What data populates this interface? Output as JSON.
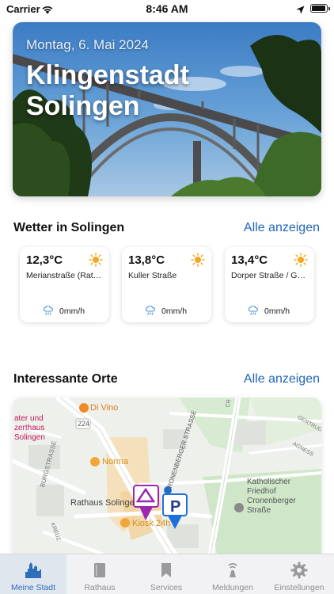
{
  "status_bar": {
    "carrier": "Carrier",
    "time": "8:46 AM",
    "battery_level": 0.95
  },
  "hero": {
    "date": "Montag, 6. Mai 2024",
    "title_line1": "Klingenstadt",
    "title_line2": "Solingen"
  },
  "weather": {
    "title": "Wetter in Solingen",
    "link": "Alle anzeigen",
    "stations": [
      {
        "temp": "12,3°C",
        "street": "Merianstraße (Rat…",
        "precip": "0mm/h",
        "icon": "sun-icon"
      },
      {
        "temp": "13,8°C",
        "street": "Kuller Straße",
        "precip": "0mm/h",
        "icon": "sun-icon"
      },
      {
        "temp": "13,4°C",
        "street": "Dorper Straße / G…",
        "precip": "0mm/h",
        "icon": "sun-icon"
      }
    ]
  },
  "places": {
    "title": "Interessante Orte",
    "link": "Alle anzeigen",
    "map_labels": {
      "theater": "ater und\nzerthaus\nSolingen",
      "di_vino": "Di Vino",
      "road_224": "224",
      "norma": "Norma",
      "rathaus": "Rathaus Solinge",
      "kiosk": "Kiosk 24h",
      "cronenberger": "CRONENBERGER STRASSE",
      "friedhof": "Katholischer\nFriedhof\nCronenberger\nStraße",
      "burgstrasse": "BURGSTRASSE",
      "gertrud": "GERTRUD",
      "agnes": "AGNESS",
      "kreuz": "KREUZ",
      "cr": "CR"
    }
  },
  "tabs": [
    {
      "label": "Meine Stadt",
      "icon": "city-icon",
      "active": true
    },
    {
      "label": "Rathaus",
      "icon": "book-icon",
      "active": false
    },
    {
      "label": "Services",
      "icon": "bookmark-icon",
      "active": false
    },
    {
      "label": "Meldungen",
      "icon": "antenna-icon",
      "active": false
    },
    {
      "label": "Einstellungen",
      "icon": "gear-icon",
      "active": false
    }
  ],
  "colors": {
    "accent": "#1f65b8",
    "tab_active": "#2d6fb8",
    "sun": "#f5a623",
    "rain": "#4a90d9",
    "pin_purple": "#9c27b0",
    "pin_blue": "#1e6fd9"
  }
}
